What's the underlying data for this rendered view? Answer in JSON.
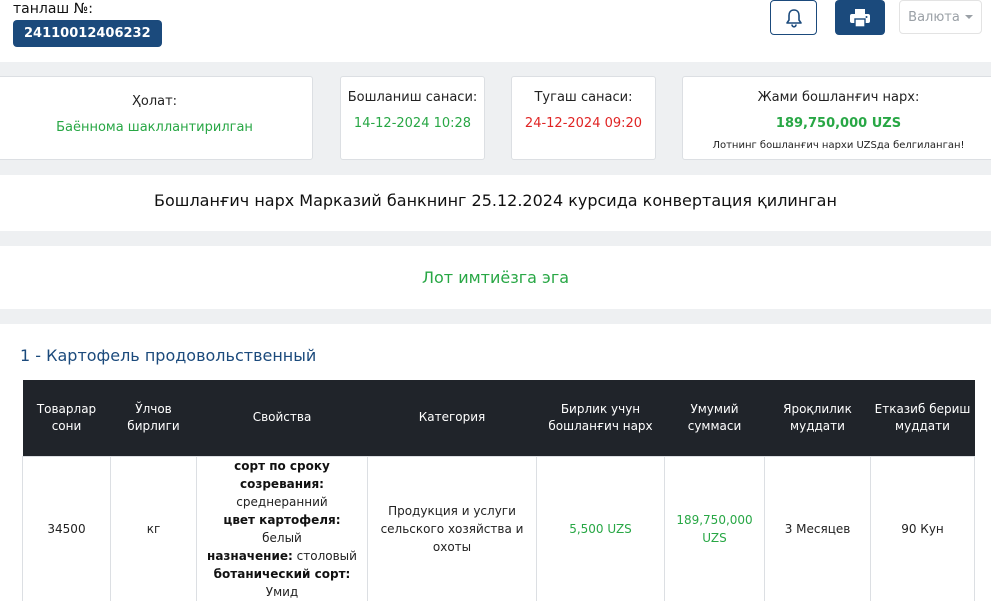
{
  "header": {
    "lot_label": "танлаш №:",
    "lot_number": "24110012406232",
    "currency_label": "Валюта"
  },
  "cards": {
    "status": {
      "label": "Ҳолат:",
      "value": "Баённома шакллантирилган"
    },
    "start": {
      "label": "Бошланиш санаси:",
      "value": "14-12-2024 10:28"
    },
    "end": {
      "label": "Тугаш санаси:",
      "value": "24-12-2024 09:20"
    },
    "total": {
      "label": "Жами бошланғич нарх:",
      "value": "189,750,000 UZS",
      "note": "Лотнинг бошланғич нархи UZSда белгиланган!"
    }
  },
  "banners": {
    "conversion": "Бошланғич нарх Марказий банкнинг 25.12.2024 курсида конвертация қилинган",
    "privilege": "Лот имтиёзга эга"
  },
  "product": {
    "title": "1 - Картофель продовольственный",
    "columns": [
      "Товарлар сони",
      "Ўлчов бирлиги",
      "Свойства",
      "Категория",
      "Бирлик учун бошланғич нарх",
      "Умумий суммаси",
      "Яроқлилик муддати",
      "Етказиб бериш муддати"
    ],
    "row": {
      "quantity": "34500",
      "unit": "кг",
      "properties": [
        {
          "name": "сорт по сроку созревания:",
          "value": "среднеранний"
        },
        {
          "name": "цвет картофеля:",
          "value": "белый"
        },
        {
          "name": "назначение:",
          "value": "столовый"
        },
        {
          "name": "ботанический сорт:",
          "value": "Умид"
        }
      ],
      "category": "Продукция и услуги сельского хозяйства и охоты",
      "unit_price": "5,500 UZS",
      "total": "189,750,000 UZS",
      "shelf_life": "3 Месяцев",
      "delivery": "90 Кун"
    }
  },
  "colors": {
    "brand": "#1b4a7c",
    "success": "#28a745",
    "danger": "#e02424",
    "table_header": "#20242a"
  }
}
